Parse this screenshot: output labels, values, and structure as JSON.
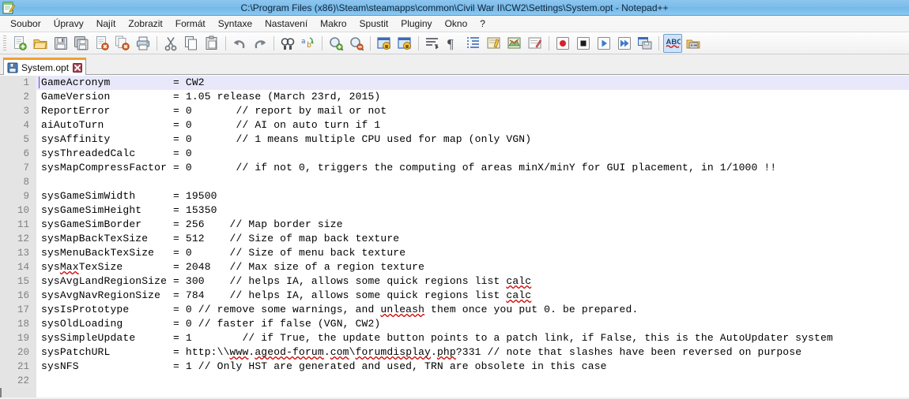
{
  "window": {
    "title": "C:\\Program Files (x86)\\Steam\\steamapps\\common\\Civil War II\\CW2\\Settings\\System.opt - Notepad++",
    "app_icon": "notepad-plus-plus-icon",
    "titlebar_color": "#7dbdea"
  },
  "menubar": {
    "items": [
      {
        "label": "Soubor",
        "name": "menu-soubor"
      },
      {
        "label": "Úpravy",
        "name": "menu-upravy"
      },
      {
        "label": "Najít",
        "name": "menu-najit"
      },
      {
        "label": "Zobrazit",
        "name": "menu-zobrazit"
      },
      {
        "label": "Formát",
        "name": "menu-format"
      },
      {
        "label": "Syntaxe",
        "name": "menu-syntaxe"
      },
      {
        "label": "Nastavení",
        "name": "menu-nastaveni"
      },
      {
        "label": "Makro",
        "name": "menu-makro"
      },
      {
        "label": "Spustit",
        "name": "menu-spustit"
      },
      {
        "label": "Pluginy",
        "name": "menu-pluginy"
      },
      {
        "label": "Okno",
        "name": "menu-okno"
      },
      {
        "label": "?",
        "name": "menu-help"
      }
    ]
  },
  "toolbar": {
    "buttons": [
      {
        "icon": "new-file-icon"
      },
      {
        "icon": "open-file-icon"
      },
      {
        "icon": "save-icon"
      },
      {
        "icon": "save-all-icon"
      },
      {
        "icon": "close-file-icon"
      },
      {
        "icon": "close-all-files-icon"
      },
      {
        "icon": "print-icon"
      },
      {
        "icon": "separator"
      },
      {
        "icon": "cut-icon"
      },
      {
        "icon": "copy-icon"
      },
      {
        "icon": "paste-icon"
      },
      {
        "icon": "separator"
      },
      {
        "icon": "undo-icon"
      },
      {
        "icon": "redo-icon"
      },
      {
        "icon": "separator"
      },
      {
        "icon": "find-icon"
      },
      {
        "icon": "replace-icon"
      },
      {
        "icon": "separator"
      },
      {
        "icon": "zoom-in-icon"
      },
      {
        "icon": "zoom-out-icon"
      },
      {
        "icon": "separator"
      },
      {
        "icon": "sync-vertical-scroll-icon"
      },
      {
        "icon": "sync-horizontal-scroll-icon"
      },
      {
        "icon": "separator"
      },
      {
        "icon": "word-wrap-icon"
      },
      {
        "icon": "show-all-characters-icon"
      },
      {
        "icon": "indent-guide-icon"
      },
      {
        "icon": "user-defined-language-icon"
      },
      {
        "icon": "show-document-map-icon"
      },
      {
        "icon": "function-list-icon"
      },
      {
        "icon": "separator"
      },
      {
        "icon": "record-macro-icon"
      },
      {
        "icon": "stop-recording-macro-icon"
      },
      {
        "icon": "play-macro-icon"
      },
      {
        "icon": "run-macro-multiple-times-icon"
      },
      {
        "icon": "save-macro-icon"
      },
      {
        "icon": "separator"
      },
      {
        "icon": "spell-check-icon",
        "active": true
      },
      {
        "icon": "run-icon"
      }
    ]
  },
  "tabs": [
    {
      "label": "System.opt",
      "icon": "saved-file-icon",
      "close_icon": "close-tab-icon",
      "active": true,
      "accent_color": "#f0a030"
    }
  ],
  "editor": {
    "current_line": 1,
    "total_lines": 22,
    "gutter_bg": "#e4e4e4",
    "current_line_bg": "#e8e8fa",
    "lines": [
      {
        "n": 1,
        "text": "GameAcronym          = CW2"
      },
      {
        "n": 2,
        "text": "GameVersion          = 1.05 release (March 23rd, 2015)"
      },
      {
        "n": 3,
        "text": "ReportError          = 0       // report by mail or not"
      },
      {
        "n": 4,
        "text": "aiAutoTurn           = 0       // AI on auto turn if 1"
      },
      {
        "n": 5,
        "text": "sysAffinity          = 0       // 1 means multiple CPU used for map (only VGN)"
      },
      {
        "n": 6,
        "text": "sysThreadedCalc      = 0"
      },
      {
        "n": 7,
        "text": "sysMapCompressFactor = 0       // if not 0, triggers the computing of areas minX/minY for GUI placement, in 1/1000 !!"
      },
      {
        "n": 8,
        "text": ""
      },
      {
        "n": 9,
        "text": "sysGameSimWidth      = 19500"
      },
      {
        "n": 10,
        "text": "sysGameSimHeight     = 15350"
      },
      {
        "n": 11,
        "text": "sysGameSimBorder     = 256    // Map border size"
      },
      {
        "n": 12,
        "text": "sysMapBackTexSize    = 512    // Size of map back texture"
      },
      {
        "n": 13,
        "text": "sysMenuBackTexSize   = 0      // Size of menu back texture"
      },
      {
        "n": 14,
        "text": "sysMaxTexSize        = 2048   // Max size of a region texture",
        "misspelled": [
          "Max"
        ]
      },
      {
        "n": 15,
        "text": "sysAvgLandRegionSize = 300    // helps IA, allows some quick regions list calc",
        "misspelled": [
          "calc"
        ]
      },
      {
        "n": 16,
        "text": "sysAvgNavRegionSize  = 784    // helps IA, allows some quick regions list calc",
        "misspelled": [
          "calc"
        ]
      },
      {
        "n": 17,
        "text": "sysIsPrototype       = 0 // remove some warnings, and unleash them once you put 0. be prepared.",
        "misspelled": [
          "unleash"
        ]
      },
      {
        "n": 18,
        "text": "sysOldLoading        = 0 // faster if false (VGN, CW2)"
      },
      {
        "n": 19,
        "text": "sysSimpleUpdate      = 1        // if True, the update button points to a patch link, if False, this is the AutoUpdater system"
      },
      {
        "n": 20,
        "text": "sysPatchURL          = http:\\\\www.ageod-forum.com\\forumdisplay.php?331 // note that slashes have been reversed on purpose",
        "misspelled": [
          "www",
          "ageod-forum",
          "com",
          "forumdisplay",
          "php"
        ]
      },
      {
        "n": 21,
        "text": "sysNFS               = 1 // Only HST are generated and used, TRN are obsolete in this case"
      },
      {
        "n": 22,
        "text": ""
      }
    ]
  }
}
